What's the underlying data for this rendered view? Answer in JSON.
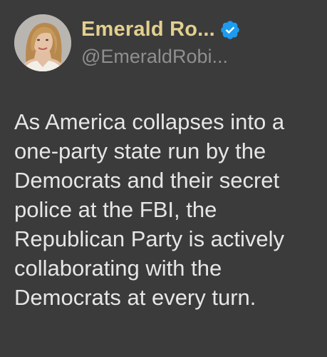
{
  "tweet": {
    "author": {
      "display_name": "Emerald Ro...",
      "handle": "@EmeraldRobi...",
      "verified": true,
      "verified_icon": "verified-badge-icon",
      "verified_color": "#1d9bf0",
      "name_color": "#e3d08e"
    },
    "text": "As America collapses into a\none-party state run by the\nDemocrats and their secret\npolice at the FBI, the\nRepublican Party is actively\ncollaborating with the\nDemocrats at every turn."
  }
}
